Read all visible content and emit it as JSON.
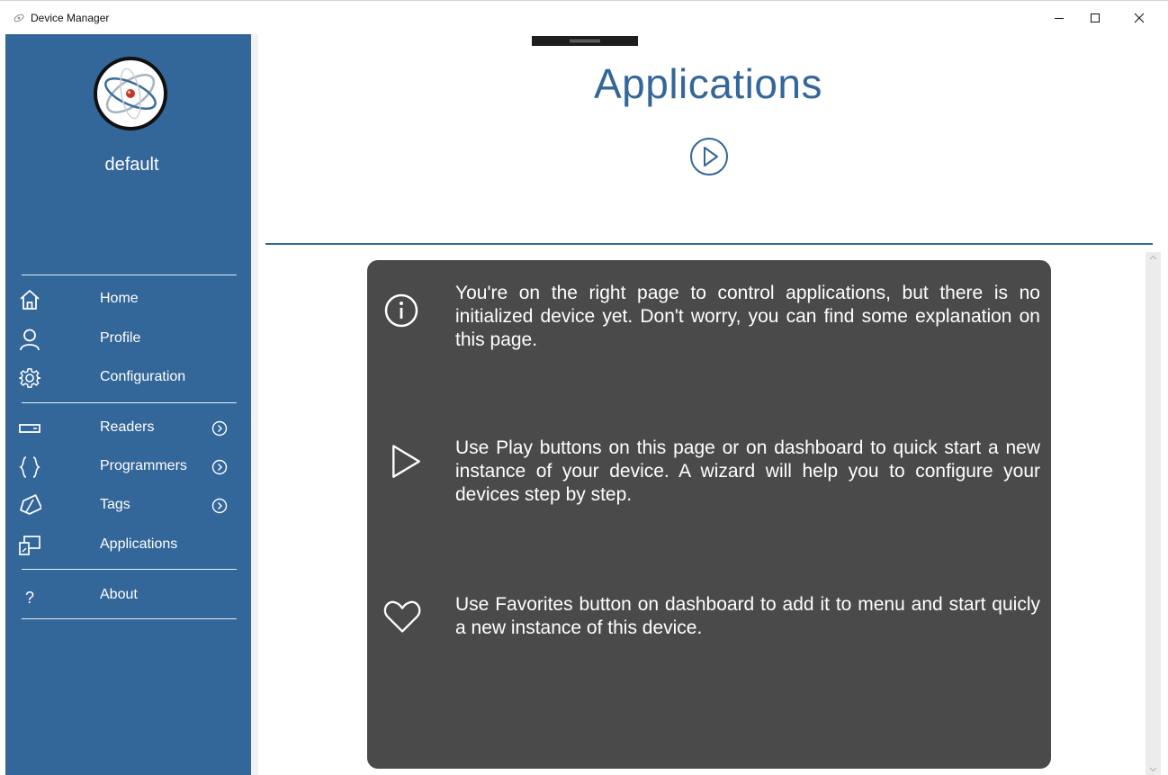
{
  "window": {
    "title": "Device Manager",
    "controls": [
      "minimize-icon",
      "maximize-icon",
      "close-icon"
    ]
  },
  "sidebar": {
    "username": "default",
    "items": [
      {
        "label": "Home",
        "icon": "home-icon"
      },
      {
        "label": "Profile",
        "icon": "user-icon"
      },
      {
        "label": "Configuration",
        "icon": "gear-icon"
      },
      {
        "label": "Readers",
        "icon": "reader-icon",
        "expandable": true
      },
      {
        "label": "Programmers",
        "icon": "braces-icon",
        "expandable": true
      },
      {
        "label": "Tags",
        "icon": "tag-icon",
        "expandable": true
      },
      {
        "label": "Applications",
        "icon": "applications-icon"
      },
      {
        "label": "About",
        "icon": "question-icon"
      }
    ]
  },
  "main": {
    "title": "Applications",
    "tips": [
      {
        "icon": "info-icon",
        "text": "You're on the right page to control applications, but there is no initialized device yet. Don't worry, you can find some explanation on this page."
      },
      {
        "icon": "play-icon",
        "text": "Use Play buttons on this page or on dashboard to quick start a new instance of your device. A wizard will help you to configure your devices step by step."
      },
      {
        "icon": "heart-icon",
        "text": "Use Favorites button on dashboard to add it to menu and start quicly a new instance of this device."
      }
    ]
  },
  "colors": {
    "sidebar": "#336699",
    "accent": "#336699",
    "panel": "#4a4a4a"
  }
}
